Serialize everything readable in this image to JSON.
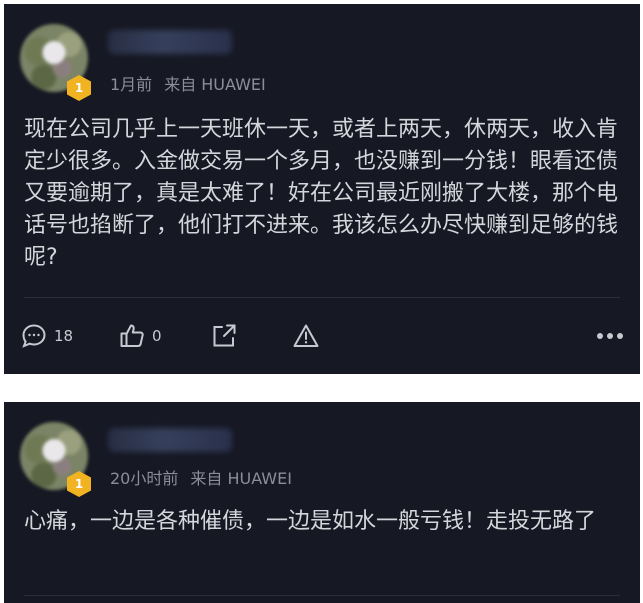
{
  "posts": [
    {
      "level": "1",
      "time": "1月前",
      "source": "来自 HUAWEI",
      "content": "现在公司几乎上一天班休一天，或者上两天，休两天，收入肯定少很多。入金做交易一个多月，也没赚到一分钱！眼看还债又要逾期了，真是太难了！好在公司最近刚搬了大楼，那个电话号也掐断了，他们打不进来。我该怎么办尽快赚到足够的钱呢?",
      "comments_count": "18",
      "likes_count": "0"
    },
    {
      "level": "1",
      "time": "20小时前",
      "source": "来自 HUAWEI",
      "content": "心痛，一边是各种催债，一边是如水一般亏钱！走投无路了"
    }
  ],
  "icons": {
    "comment": "comment-icon",
    "like": "thumbs-up-icon",
    "share": "share-icon",
    "report": "warning-icon",
    "more": "more-icon"
  },
  "colors": {
    "card_bg": "#161823",
    "text": "#d5d6dc",
    "meta": "#8b8d99",
    "badge": "#f1b321"
  }
}
